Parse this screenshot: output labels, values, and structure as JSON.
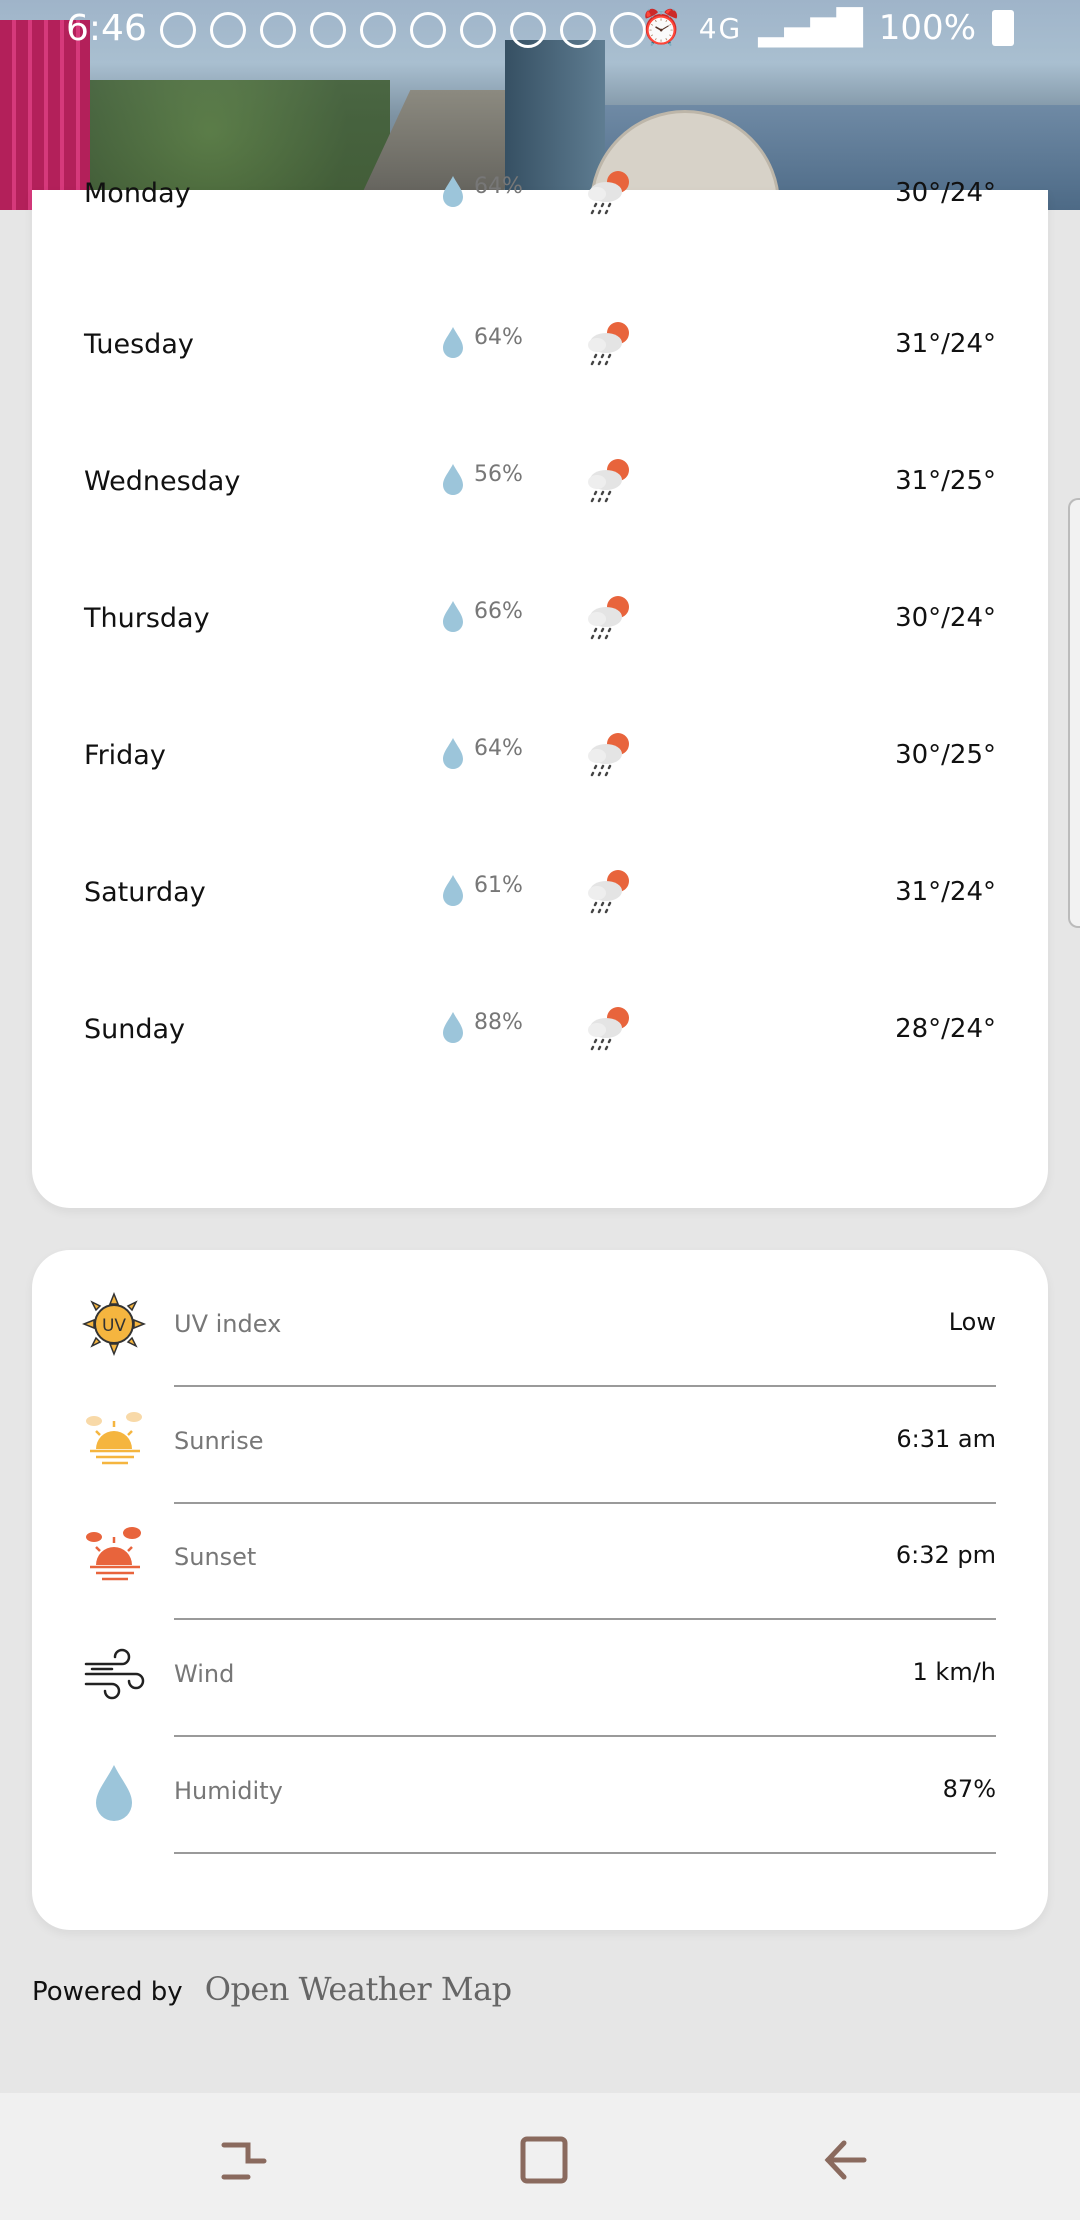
{
  "status_bar": {
    "time": "6:46",
    "network": "4G",
    "battery": "100%"
  },
  "forecast": [
    {
      "day": "Monday",
      "precip": "64%",
      "temp": "30°/24°"
    },
    {
      "day": "Tuesday",
      "precip": "64%",
      "temp": "31°/24°"
    },
    {
      "day": "Wednesday",
      "precip": "56%",
      "temp": "31°/25°"
    },
    {
      "day": "Thursday",
      "precip": "66%",
      "temp": "30°/24°"
    },
    {
      "day": "Friday",
      "precip": "64%",
      "temp": "30°/25°"
    },
    {
      "day": "Saturday",
      "precip": "61%",
      "temp": "31°/24°"
    },
    {
      "day": "Sunday",
      "precip": "88%",
      "temp": "28°/24°"
    }
  ],
  "details": [
    {
      "label": "UV index",
      "value": "Low",
      "icon": "uv-sun-icon"
    },
    {
      "label": "Sunrise",
      "value": "6:31 am",
      "icon": "sunrise-icon"
    },
    {
      "label": "Sunset",
      "value": "6:32 pm",
      "icon": "sunset-icon"
    },
    {
      "label": "Wind",
      "value": "1 km/h",
      "icon": "wind-icon"
    },
    {
      "label": "Humidity",
      "value": "87%",
      "icon": "droplet-icon"
    }
  ],
  "footer": {
    "powered_by": "Powered by",
    "brand": "Open Weather Map"
  },
  "colors": {
    "drop": "#9cc5da",
    "sun_orange": "#e8643c",
    "sunrise_yellow": "#f5b53f",
    "background": "#e6e6e6"
  }
}
